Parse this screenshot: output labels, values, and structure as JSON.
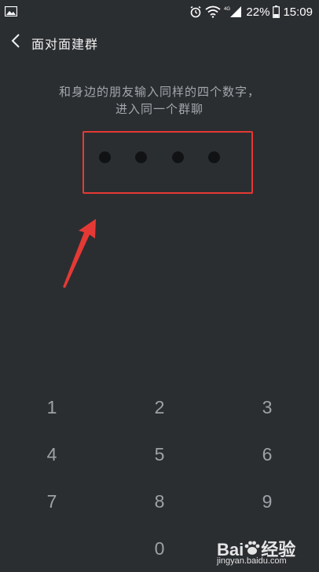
{
  "status_bar": {
    "battery_percent": "22%",
    "time": "15:09",
    "network_label": "4G"
  },
  "nav": {
    "title": "面对面建群"
  },
  "hint": {
    "line1": "和身边的朋友输入同样的四个数字，",
    "line2": "进入同一个群聊"
  },
  "code_input": {
    "digits_entered": 0,
    "digit_count": 4
  },
  "keypad": {
    "keys": [
      "1",
      "2",
      "3",
      "4",
      "5",
      "6",
      "7",
      "8",
      "9",
      "0"
    ]
  },
  "watermark": {
    "brand_left": "Bai",
    "brand_right": "经验",
    "url": "jingyan.baidu.com"
  },
  "colors": {
    "background": "#2b2e31",
    "annotation_red": "#e53935",
    "key_text": "#9ea2a6"
  }
}
